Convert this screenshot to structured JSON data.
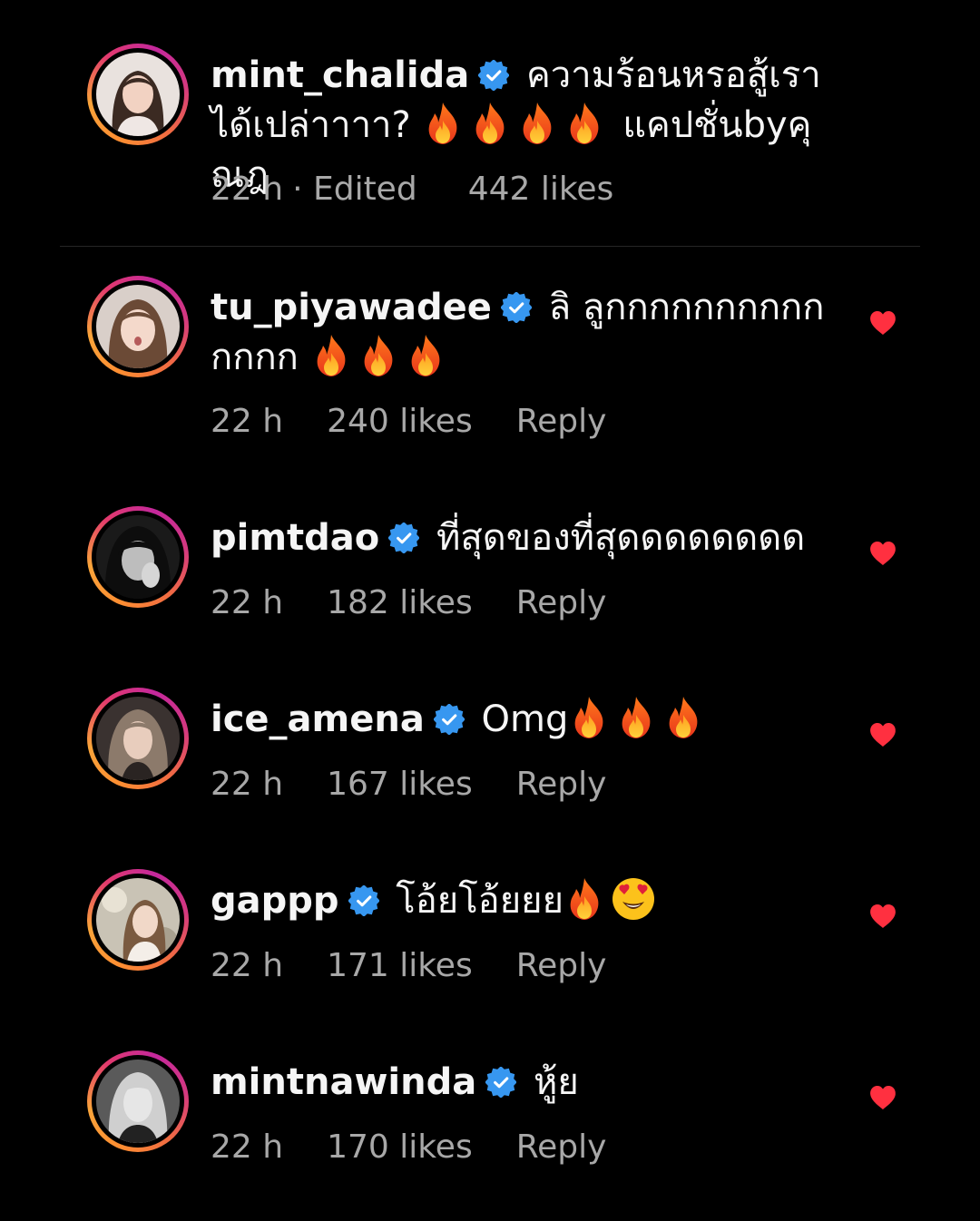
{
  "colors": {
    "background": "#000000",
    "text": "#f5f5f5",
    "meta": "#a8a8a8",
    "verified": "#3797f0",
    "heart": "#ff3040"
  },
  "caption": {
    "username": "mint_chalida",
    "text": "ความร้อนหรอสู้เราได้เปล่าาาา?",
    "fire_count": 4,
    "text_after": "แคปชั่นbyคุณฎ",
    "time": "22 h",
    "edited": "· Edited",
    "likes": "442 likes"
  },
  "comments": [
    {
      "username": "tu_piyawadee",
      "text": "ลิ ลูกกกกกกกกกกกกกก",
      "fire_count": 3,
      "time": "22 h",
      "likes": "240 likes",
      "reply": "Reply",
      "liked_icon": "heart-icon"
    },
    {
      "username": "pimtdao",
      "text": "ที่สุดของที่สุดดดดดดดด",
      "fire_count": 0,
      "time": "22 h",
      "likes": "182 likes",
      "reply": "Reply",
      "liked_icon": "heart-icon"
    },
    {
      "username": "ice_amena",
      "text": "Omg",
      "fire_count": 3,
      "time": "22 h",
      "likes": "167 likes",
      "reply": "Reply",
      "liked_icon": "heart-icon"
    },
    {
      "username": "gappp",
      "text": "โอ้ยโอ้ยยย",
      "fire_count": 1,
      "emoji_after": "heart-eyes-icon",
      "time": "22 h",
      "likes": "171 likes",
      "reply": "Reply",
      "liked_icon": "heart-icon"
    },
    {
      "username": "mintnawinda",
      "text": "หู้ย",
      "fire_count": 0,
      "time": "22 h",
      "likes": "170 likes",
      "reply": "Reply",
      "liked_icon": "heart-icon"
    }
  ]
}
